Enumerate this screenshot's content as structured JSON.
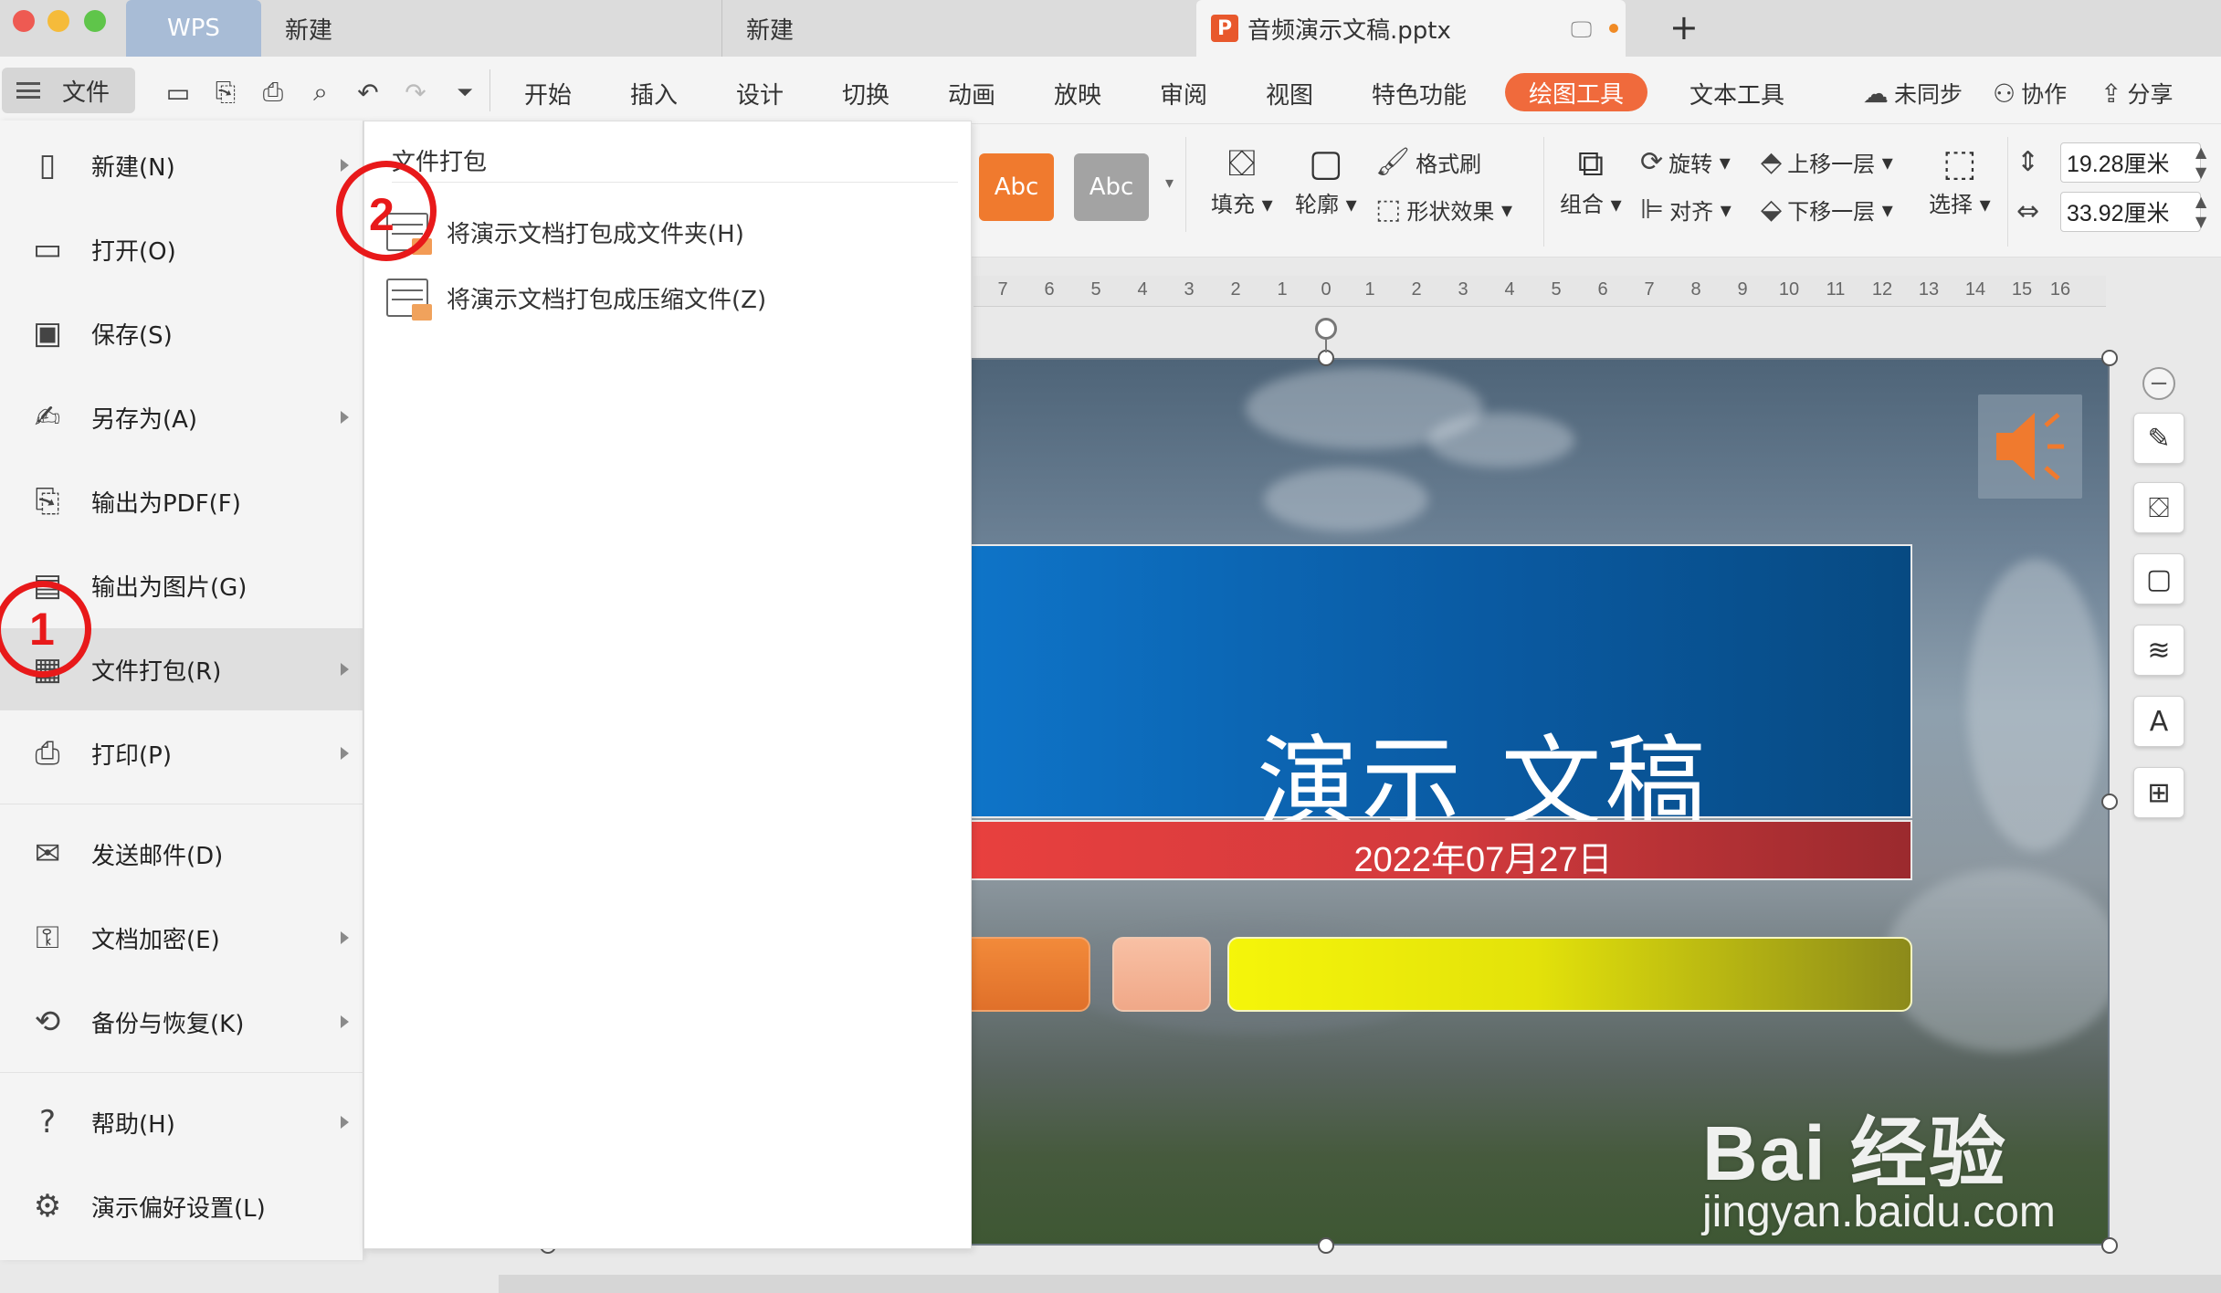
{
  "titlebar": {
    "tabs": [
      {
        "label": "WPS"
      },
      {
        "label": "新建"
      },
      {
        "label": "新建"
      },
      {
        "label": "音频演示文稿.pptx"
      }
    ],
    "new_tab_symbol": "+"
  },
  "toolbar": {
    "file_label": "文件",
    "menu_tabs": [
      "开始",
      "插入",
      "设计",
      "切换",
      "动画",
      "放映",
      "审阅",
      "视图",
      "特色功能",
      "绘图工具",
      "文本工具"
    ],
    "sync_label": "未同步",
    "collab_label": "协作",
    "share_label": "分享"
  },
  "ribbon": {
    "style_preset_1": "Abc",
    "style_preset_2": "Abc",
    "fill_label": "填充",
    "outline_label": "轮廓",
    "format_painter_label": "格式刷",
    "shape_effect_label": "形状效果",
    "group_label": "组合",
    "rotate_label": "旋转",
    "align_label": "对齐",
    "bring_forward_label": "上移一层",
    "send_backward_label": "下移一层",
    "select_label": "选择",
    "height_value": "19.28厘米",
    "width_value": "33.92厘米",
    "colors": {
      "preset_orange": "#f07a2e",
      "preset_gray": "#a3a3a3",
      "accent": "#f06a3c"
    }
  },
  "ruler": {
    "ticks": [
      "7",
      "6",
      "5",
      "4",
      "3",
      "2",
      "1",
      "0",
      "1",
      "2",
      "3",
      "4",
      "5",
      "6",
      "7",
      "8",
      "9",
      "10",
      "11",
      "12",
      "13",
      "14",
      "15",
      "16"
    ]
  },
  "file_menu": {
    "items": [
      {
        "label": "新建(N)",
        "icon": "new-doc-icon"
      },
      {
        "label": "打开(O)",
        "icon": "folder-icon"
      },
      {
        "label": "保存(S)",
        "icon": "save-icon"
      },
      {
        "label": "另存为(A)",
        "icon": "save-as-icon"
      },
      {
        "label": "输出为PDF(F)",
        "icon": "pdf-export-icon"
      },
      {
        "label": "输出为图片(G)",
        "icon": "image-export-icon"
      },
      {
        "label": "文件打包(R)",
        "icon": "package-icon"
      },
      {
        "label": "打印(P)",
        "icon": "print-icon"
      },
      {
        "label": "发送邮件(D)",
        "icon": "mail-icon"
      },
      {
        "label": "文档加密(E)",
        "icon": "encrypt-icon"
      },
      {
        "label": "备份与恢复(K)",
        "icon": "backup-icon"
      },
      {
        "label": "帮助(H)",
        "icon": "help-icon"
      },
      {
        "label": "演示偏好设置(L)",
        "icon": "gear-icon"
      }
    ]
  },
  "submenu": {
    "header": "文件打包",
    "items": [
      {
        "label": "将演示文档打包成文件夹(H)"
      },
      {
        "label": "将演示文档打包成压缩文件(Z)"
      }
    ]
  },
  "slide": {
    "title": "演示 文稿",
    "date": "2022年07月27日"
  },
  "annotations": {
    "step1": "1",
    "step2": "2"
  },
  "watermark": {
    "main": "Bai 经验",
    "sub": "jingyan.baidu.com"
  }
}
